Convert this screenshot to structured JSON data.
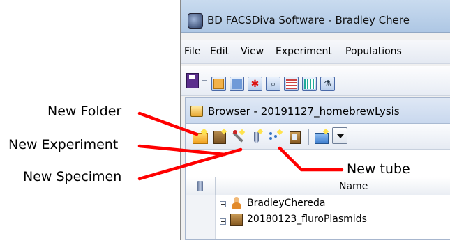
{
  "window": {
    "title": "BD FACSDiva Software - Bradley Chere"
  },
  "menu": {
    "items": [
      "File",
      "Edit",
      "View",
      "Experiment",
      "Populations"
    ]
  },
  "browser": {
    "title": "Browser - 20191127_homebrewLysis",
    "column_name": "Name",
    "tree": {
      "user": "BradleyChereda",
      "first_experiment": "20180123_fluroPlasmids"
    }
  },
  "annotations": {
    "new_folder": "New Folder",
    "new_experiment": "New Experiment",
    "new_specimen": "New Specimen",
    "new_tube": "New tube",
    "arrow_color": "#ff0000"
  }
}
